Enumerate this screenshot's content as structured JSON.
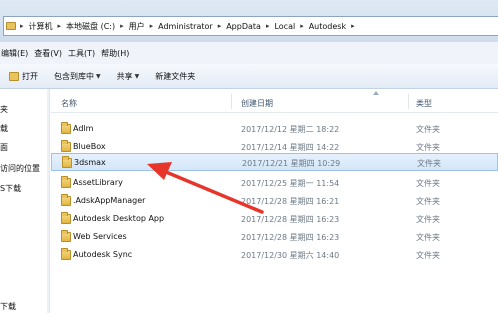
{
  "address_bar": {
    "crumbs": [
      "计算机",
      "本地磁盘 (C:)",
      "用户",
      "Administrator",
      "AppData",
      "Local",
      "Autodesk"
    ]
  },
  "menu": {
    "items": [
      "编辑(E)",
      "查看(V)",
      "工具(T)",
      "帮助(H)"
    ]
  },
  "toolbar": {
    "open_label": "打开",
    "include_label": "包含到库中",
    "share_label": "共享",
    "new_folder_label": "新建文件夹"
  },
  "nav_pane": {
    "items": [
      "夹",
      "载",
      "面",
      "访问的位置",
      "S下载",
      "",
      "",
      "",
      "",
      "下载"
    ]
  },
  "columns": {
    "name": "名称",
    "date": "创建日期",
    "type": "类型"
  },
  "files": [
    {
      "name": "Adlm",
      "date": "2017/12/12 星期二 18:22",
      "type": "文件夹"
    },
    {
      "name": "BlueBox",
      "date": "2017/12/14 星期四 14:22",
      "type": "文件夹"
    },
    {
      "name": "3dsmax",
      "date": "2017/12/21 星期四 10:29",
      "type": "文件夹",
      "selected": true
    },
    {
      "name": "AssetLibrary",
      "date": "2017/12/25 星期一 11:54",
      "type": "文件夹"
    },
    {
      "name": ".AdskAppManager",
      "date": "2017/12/28 星期四 16:21",
      "type": "文件夹"
    },
    {
      "name": "Autodesk Desktop App",
      "date": "2017/12/28 星期四 16:23",
      "type": "文件夹"
    },
    {
      "name": "Web Services",
      "date": "2017/12/28 星期四 16:23",
      "type": "文件夹"
    },
    {
      "name": "Autodesk Sync",
      "date": "2017/12/30 星期六 14:40",
      "type": "文件夹"
    }
  ],
  "colors": {
    "selection_fill": "#d4e6f9",
    "selection_border": "#9ec3ea",
    "arrow": "#e8352b",
    "folder": "#e2b53f"
  }
}
